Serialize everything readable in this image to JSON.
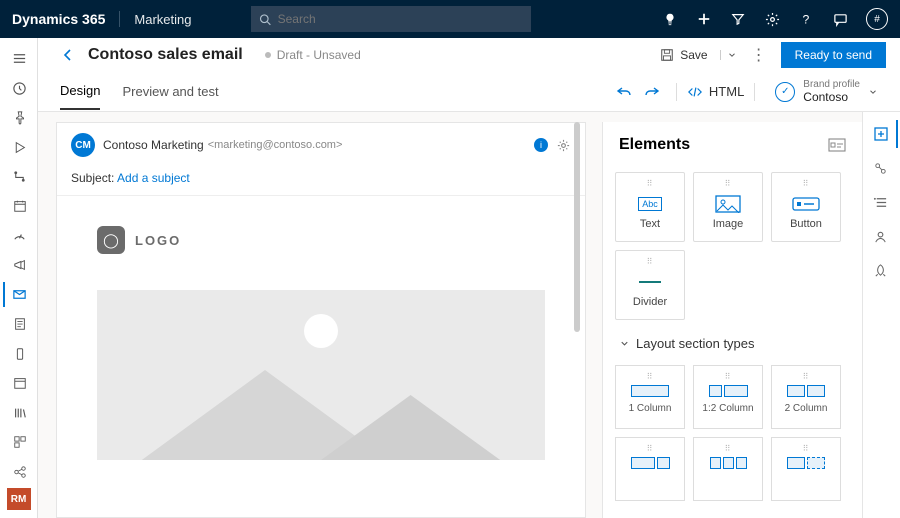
{
  "topbar": {
    "brand": "Dynamics 365",
    "app": "Marketing",
    "search_placeholder": "Search",
    "avatar": "#"
  },
  "leftrail": {
    "badge": "RM"
  },
  "cmdbar": {
    "title": "Contoso sales email",
    "status": "Draft - Unsaved",
    "save_label": "Save",
    "primary_label": "Ready to send"
  },
  "tabs": {
    "design": "Design",
    "preview": "Preview and test",
    "html": "HTML",
    "brand_label": "Brand profile",
    "brand_value": "Contoso"
  },
  "canvas": {
    "avatar": "CM",
    "sender_name": "Contoso Marketing",
    "sender_email": "<marketing@contoso.com>",
    "subject_label": "Subject:",
    "subject_link": "Add a subject",
    "logo_text": "LOGO"
  },
  "panel": {
    "title": "Elements",
    "text": "Text",
    "image": "Image",
    "button": "Button",
    "divider": "Divider",
    "section_header": "Layout section types",
    "l1": "1 Column",
    "l12": "1:2 Column",
    "l2": "2 Column"
  }
}
